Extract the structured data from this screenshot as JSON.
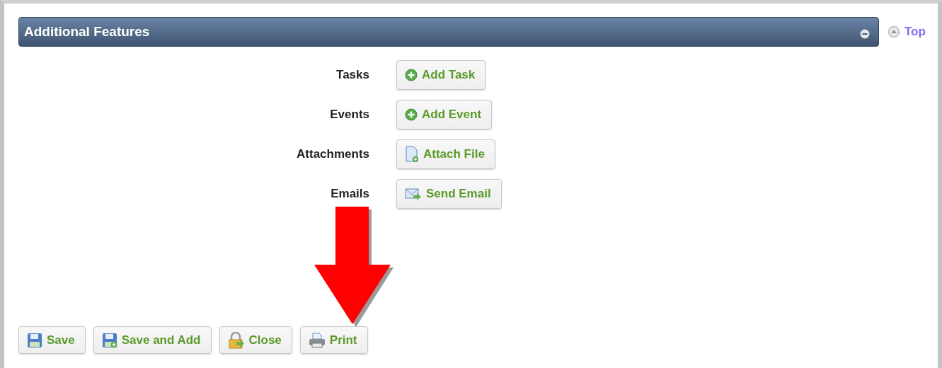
{
  "panel": {
    "title": "Additional Features",
    "expanded": true
  },
  "top_link": "Top",
  "features": [
    {
      "label": "Tasks",
      "button": "Add Task",
      "kind": "add"
    },
    {
      "label": "Events",
      "button": "Add Event",
      "kind": "add"
    },
    {
      "label": "Attachments",
      "button": "Attach File",
      "kind": "file"
    },
    {
      "label": "Emails",
      "button": "Send Email",
      "kind": "email"
    }
  ],
  "actions": [
    {
      "label": "Save",
      "kind": "save"
    },
    {
      "label": "Save and Add",
      "kind": "save-add"
    },
    {
      "label": "Close",
      "kind": "close"
    },
    {
      "label": "Print",
      "kind": "print"
    }
  ]
}
